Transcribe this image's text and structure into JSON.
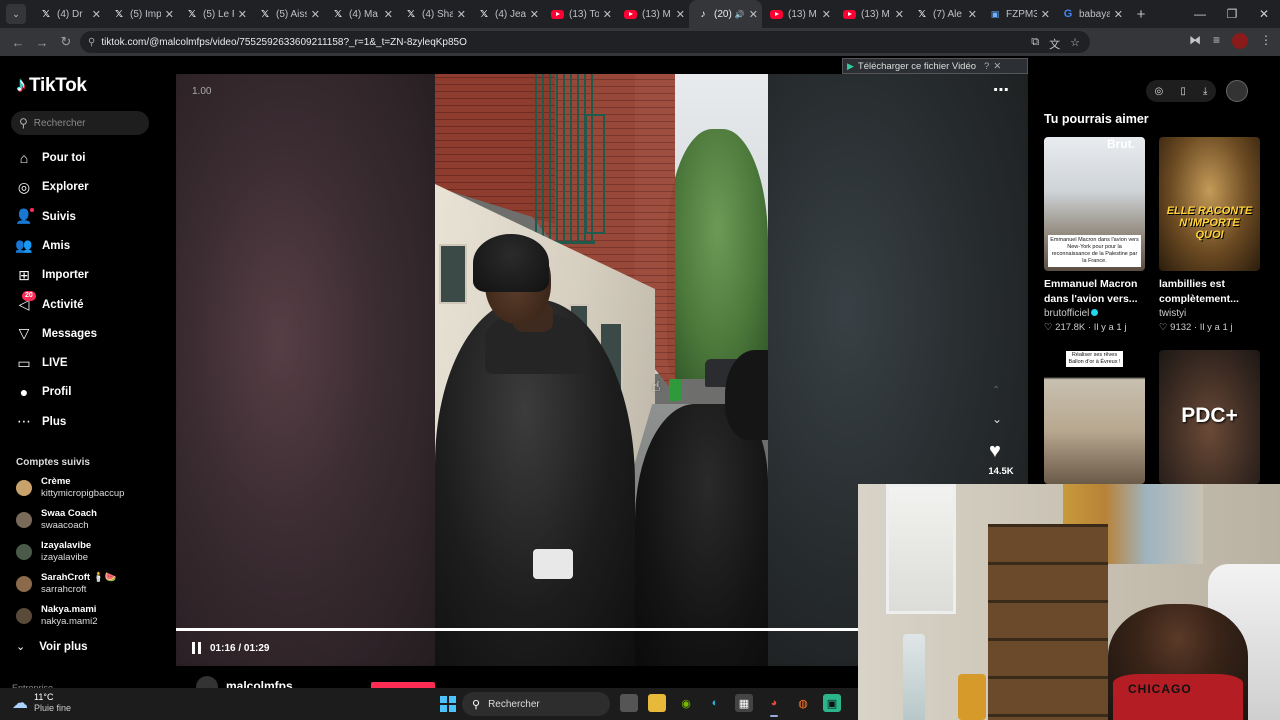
{
  "browser": {
    "tabs": [
      {
        "label": "(4) Dr",
        "icon": "x-logo-icon",
        "active": false
      },
      {
        "label": "(5) Imp",
        "icon": "x-logo-icon",
        "active": false
      },
      {
        "label": "(5) Le F",
        "icon": "x-logo-icon",
        "active": false
      },
      {
        "label": "(5) Aiss",
        "icon": "x-logo-icon",
        "active": false
      },
      {
        "label": "(4) Ma",
        "icon": "x-logo-icon",
        "active": false
      },
      {
        "label": "(4) Sha",
        "icon": "x-logo-icon",
        "active": false
      },
      {
        "label": "(4) Jean",
        "icon": "x-logo-icon",
        "active": false
      },
      {
        "label": "(13) To",
        "icon": "youtube-icon",
        "active": false
      },
      {
        "label": "(13) M",
        "icon": "youtube-icon",
        "active": false
      },
      {
        "label": "(20)",
        "icon": "tiktok-icon",
        "active": true
      },
      {
        "label": "(13) M",
        "icon": "youtube-icon",
        "active": false
      },
      {
        "label": "(13) M",
        "icon": "youtube-icon",
        "active": false
      },
      {
        "label": "(7) Ale",
        "icon": "x-logo-icon",
        "active": false
      },
      {
        "label": "FZPM3",
        "icon": "site-icon",
        "active": false
      },
      {
        "label": "babaya",
        "icon": "google-icon",
        "active": false
      }
    ],
    "url": "tiktok.com/@malcolmfps/video/7552592633609211158?_r=1&_t=ZN-8zyleqKp85O"
  },
  "sidebar": {
    "logo": "TikTok",
    "search_placeholder": "Rechercher",
    "nav": [
      {
        "label": "Pour toi",
        "icon": "home-icon"
      },
      {
        "label": "Explorer",
        "icon": "compass-icon"
      },
      {
        "label": "Suivis",
        "icon": "following-icon"
      },
      {
        "label": "Amis",
        "icon": "friends-icon"
      },
      {
        "label": "Importer",
        "icon": "upload-icon"
      },
      {
        "label": "Activité",
        "icon": "activity-icon",
        "badge": "20"
      },
      {
        "label": "Messages",
        "icon": "messages-icon"
      },
      {
        "label": "LIVE",
        "icon": "live-icon"
      },
      {
        "label": "Profil",
        "icon": "profile-icon"
      },
      {
        "label": "Plus",
        "icon": "more-icon"
      }
    ],
    "following_title": "Comptes suivis",
    "following": [
      {
        "name": "Crème",
        "handle": "kittymicropigbaccup",
        "color": "#c9a26b"
      },
      {
        "name": "Swaa Coach",
        "handle": "swaacoach",
        "color": "#7a6a5a"
      },
      {
        "name": "Izayalavibe",
        "handle": "izayalavibe",
        "color": "#4a5a4a"
      },
      {
        "name": "SarahCroft 🕯️🍉",
        "handle": "sarrahcroft",
        "color": "#8a6a4a"
      },
      {
        "name": "Nakya.mami",
        "handle": "nakya.mami2",
        "color": "#5a4a3a"
      }
    ],
    "see_more": "Voir plus",
    "footer_partial": "Entreprise"
  },
  "video": {
    "speed": "1.00",
    "time": "01:16 / 01:29",
    "progress": 0.853,
    "likes": "14.5K",
    "author": "malcolmfps"
  },
  "download_overlay": {
    "label": "Télécharger ce fichier Vidéo",
    "help": "?",
    "close": "✕"
  },
  "recommendations": {
    "title": "Tu pourrais aimer",
    "cards": [
      {
        "title_line1": "Emmanuel Macron",
        "title_line2": "dans l'avion vers...",
        "author": "brutofficiel",
        "verified": true,
        "likes": "217.8K",
        "age": "Il y a 1 j",
        "thumb_brand": "Brut.",
        "thumb_caption": "Emmanuel Macron dans l'avion vers New-York pour pour la reconnaissance de la Palestine par la France."
      },
      {
        "title_line1": "lambillies est",
        "title_line2": "complètement...",
        "author": "twistyi",
        "verified": false,
        "likes": "9132",
        "age": "Il y a 1 j",
        "thumb_caption": "ELLE RACONTE N'IMPORTE QUOI"
      },
      {
        "thumb_caption": "Réaliser ses rêves Ballon d'or à Évreux !"
      },
      {
        "thumb_caption": "PDC+"
      }
    ]
  },
  "webcam": {
    "jersey_text": "CHICAGO"
  },
  "taskbar": {
    "temperature": "11°C",
    "condition": "Pluie fine",
    "search_label": "Rechercher"
  }
}
